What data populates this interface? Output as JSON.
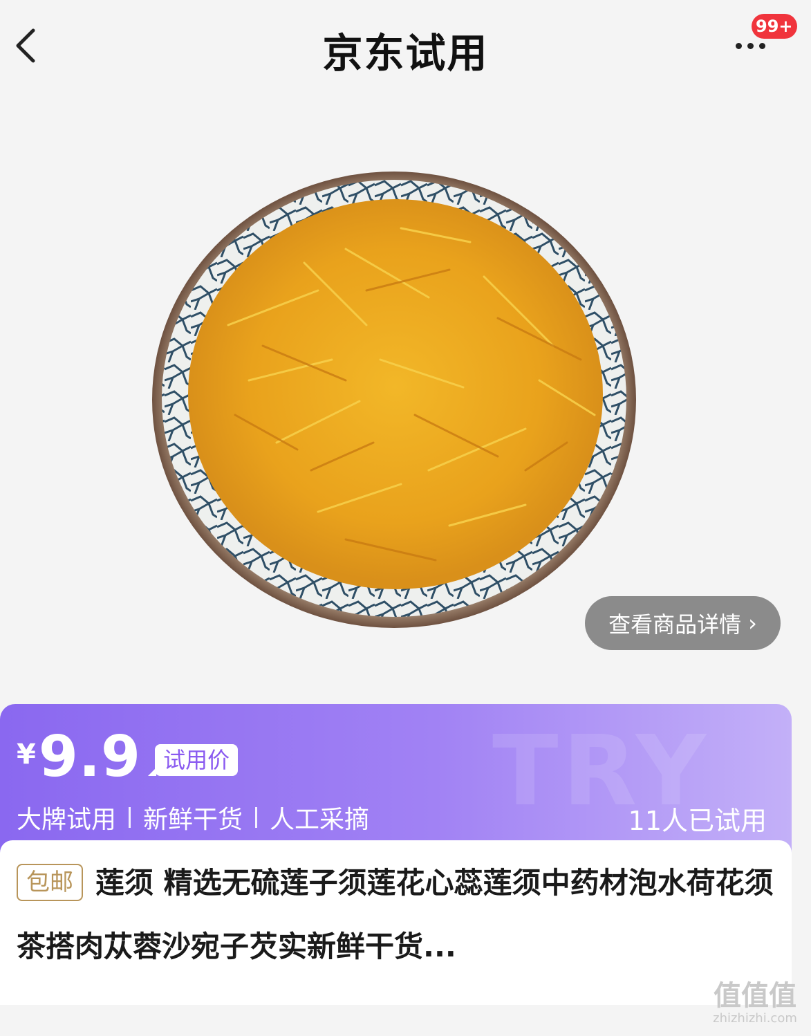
{
  "header": {
    "title": "京东试用",
    "badge": "99+"
  },
  "product": {
    "detail_button_label": "查看商品详情",
    "detail_chevron": "›"
  },
  "price_banner": {
    "currency": "¥",
    "price": "9.9",
    "trial_label": "试用价",
    "watermark": "TRY",
    "tags": [
      "大牌试用",
      "新鲜干货",
      "人工采摘"
    ],
    "trial_count": "11人已试用"
  },
  "title_card": {
    "shipping_tag": "包邮",
    "title": "莲须 精选无硫莲子须莲花心蕊莲须中药材泡水荷花须茶搭肉苁蓉沙宛子芡实新鲜干货..."
  },
  "site_watermark": {
    "logo": "值值值",
    "url": "zhizhizhi.com"
  },
  "colors": {
    "banner_start": "#8a68f0",
    "banner_end": "#c3b0f8",
    "badge_red": "#f0343c",
    "ship_tag_gold": "#b8955a"
  }
}
